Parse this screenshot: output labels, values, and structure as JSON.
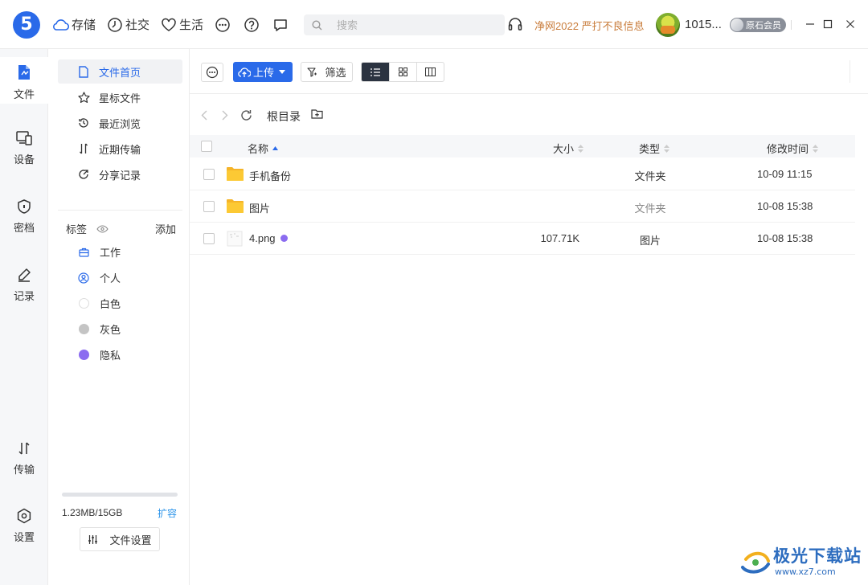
{
  "app": {
    "logo_text": "5",
    "brand_color": "#2a6ae9",
    "promo_text": "净网2022 严打不良信息",
    "user": {
      "name": "1015...",
      "member_badge": "原石会员"
    },
    "search_placeholder": "搜索"
  },
  "topnav": [
    {
      "label": "存储",
      "icon": "cloud-icon"
    },
    {
      "label": "社交",
      "icon": "clock-icon"
    },
    {
      "label": "生活",
      "icon": "heart-icon"
    }
  ],
  "rail": [
    {
      "label": "文件",
      "icon": "file-icon",
      "active": true
    },
    {
      "label": "设备",
      "icon": "devices-icon"
    },
    {
      "label": "密档",
      "icon": "shield-icon"
    },
    {
      "label": "记录",
      "icon": "pen-icon"
    },
    {
      "label": "传输",
      "icon": "transfer-icon"
    },
    {
      "label": "设置",
      "icon": "settings-icon"
    }
  ],
  "sidebar": {
    "items": [
      {
        "label": "文件首页",
        "icon": "file-home-icon",
        "active": true
      },
      {
        "label": "星标文件",
        "icon": "star-icon"
      },
      {
        "label": "最近浏览",
        "icon": "history-icon"
      },
      {
        "label": "近期传输",
        "icon": "transfer-icon"
      },
      {
        "label": "分享记录",
        "icon": "share-icon"
      }
    ],
    "tags_title": "标签",
    "tags_add": "添加",
    "tags": [
      {
        "label": "工作",
        "icon": "briefcase-icon"
      },
      {
        "label": "个人",
        "icon": "person-icon"
      },
      {
        "label": "白色",
        "color": "#ffffff"
      },
      {
        "label": "灰色",
        "color": "#c4c4c4"
      },
      {
        "label": "隐私",
        "color": "#8b6cf0"
      }
    ],
    "storage": {
      "used_text": "1.23MB/15GB",
      "expand_label": "扩容",
      "used_fraction": 0.0001
    },
    "file_settings_label": "文件设置"
  },
  "toolbar": {
    "upload_label": "上传",
    "filter_label": "筛选"
  },
  "path": {
    "current": "根目录"
  },
  "table": {
    "headers": {
      "name": "名称",
      "size": "大小",
      "type": "类型",
      "modified": "修改时间"
    },
    "rows": [
      {
        "name": "手机备份",
        "size": "",
        "type": "文件夹",
        "modified": "10-09 11:15",
        "kind": "folder"
      },
      {
        "name": "图片",
        "size": "",
        "type": "文件夹",
        "modified": "10-08 15:38",
        "kind": "folder"
      },
      {
        "name": "4.png",
        "size": "107.71K",
        "type": "图片",
        "modified": "10-08 15:38",
        "kind": "image",
        "tag_color": "#8b6cf0"
      }
    ]
  },
  "watermark": {
    "title": "极光下载站",
    "url": "www.xz7.com"
  }
}
